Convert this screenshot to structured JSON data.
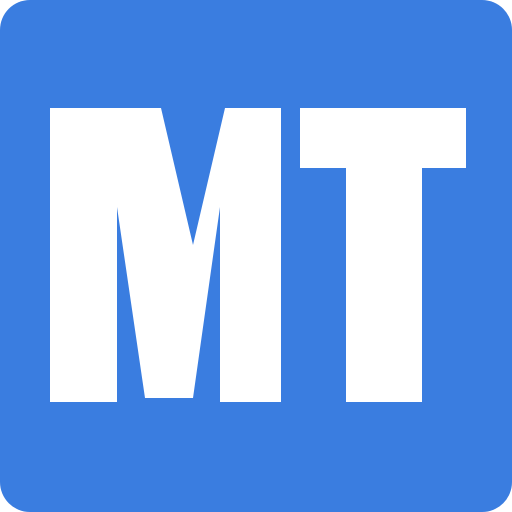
{
  "icon": {
    "name": "mt-app-icon",
    "monogram": "MT",
    "colors": {
      "background": "#3A7DE0",
      "foreground": "#FFFFFF"
    }
  }
}
